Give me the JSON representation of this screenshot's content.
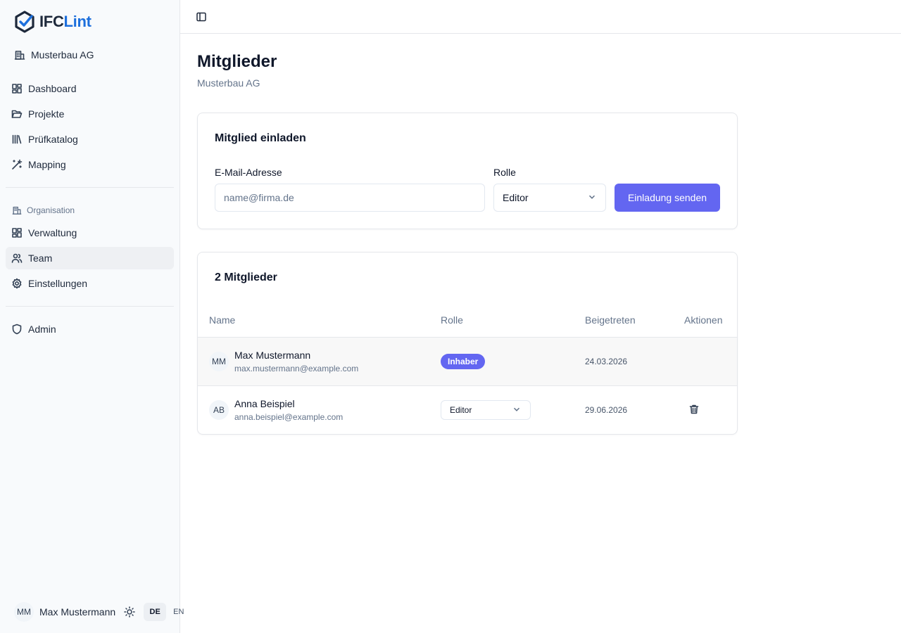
{
  "brand": {
    "name_part1": "IFC",
    "name_part2": "Lint",
    "colors": {
      "dark": "#1e293b",
      "blue": "#1d6fdc"
    }
  },
  "sidebar": {
    "org_name": "Musterbau AG",
    "main_nav": [
      {
        "label": "Dashboard",
        "icon": "dashboard-icon"
      },
      {
        "label": "Projekte",
        "icon": "folder-icon"
      },
      {
        "label": "Prüfkatalog",
        "icon": "library-icon"
      },
      {
        "label": "Mapping",
        "icon": "wand-icon"
      }
    ],
    "section_label": "Organisation",
    "org_nav": [
      {
        "label": "Verwaltung",
        "icon": "dashboard-icon"
      },
      {
        "label": "Team",
        "icon": "users-icon",
        "active": true
      },
      {
        "label": "Einstellungen",
        "icon": "gear-icon"
      }
    ],
    "admin_label": "Admin",
    "footer": {
      "initials": "MM",
      "user_name": "Max Mustermann",
      "lang_active": "DE",
      "lang_other": "EN"
    }
  },
  "page": {
    "title": "Mitglieder",
    "subtitle": "Musterbau AG"
  },
  "invite": {
    "title": "Mitglied einladen",
    "email_label": "E-Mail-Adresse",
    "email_placeholder": "name@firma.de",
    "email_value": "",
    "role_label": "Rolle",
    "role_value": "Editor",
    "submit_label": "Einladung senden",
    "accent_color": "#6366f1"
  },
  "members": {
    "title": "2 Mitglieder",
    "columns": {
      "name": "Name",
      "role": "Rolle",
      "joined": "Beigetreten",
      "actions": "Aktionen"
    },
    "rows": [
      {
        "initials": "MM",
        "name": "Max Mustermann",
        "email": "max.mustermann@example.com",
        "role": "Inhaber",
        "role_kind": "badge",
        "joined": "24.03.2026",
        "deletable": false
      },
      {
        "initials": "AB",
        "name": "Anna Beispiel",
        "email": "anna.beispiel@example.com",
        "role": "Editor",
        "role_kind": "select",
        "joined": "29.06.2026",
        "deletable": true
      }
    ]
  }
}
